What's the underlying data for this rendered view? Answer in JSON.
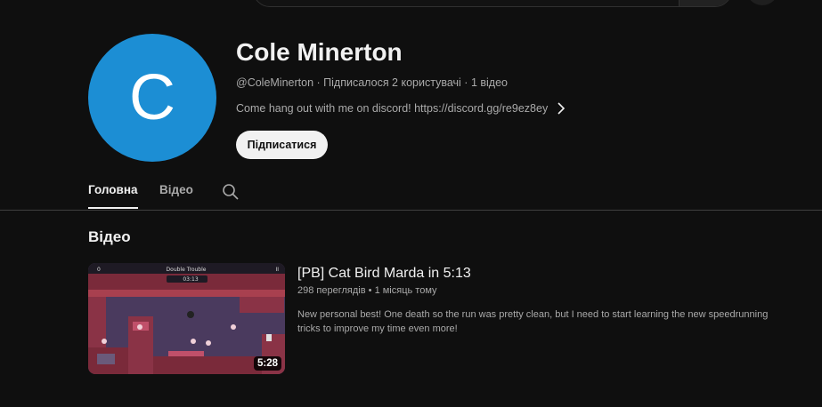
{
  "channel": {
    "avatar_letter": "C",
    "avatar_color": "#1c8ed4",
    "name": "Cole Minerton",
    "handle": "@ColeMinerton",
    "subscribers": "Підписалося 2 користувачі",
    "video_count": "1 відео",
    "separator": "·",
    "description": "Come hang out with me on discord! https://discord.gg/re9ez8ey",
    "subscribe_label": "Підписатися"
  },
  "tabs": [
    {
      "label": "Головна",
      "active": true
    },
    {
      "label": "Відео",
      "active": false
    }
  ],
  "icons": {
    "tab_search": "search-icon",
    "description_more": "chevron-right-icon"
  },
  "section": {
    "title": "Відео"
  },
  "video": {
    "title": "[PB] Cat Bird Marda in 5:13",
    "views": "298 переглядів",
    "age": "1 місяць тому",
    "dot": "•",
    "description": "New personal best! One death so the run was pretty clean, but I need to start learning the new speedrunning tricks to improve my time even more!",
    "duration": "5:28",
    "thumb_hud_title": "Double Trouble",
    "thumb_hud_timer": "03:13",
    "thumb_hud_left": "0",
    "thumb_hud_right": "II"
  }
}
